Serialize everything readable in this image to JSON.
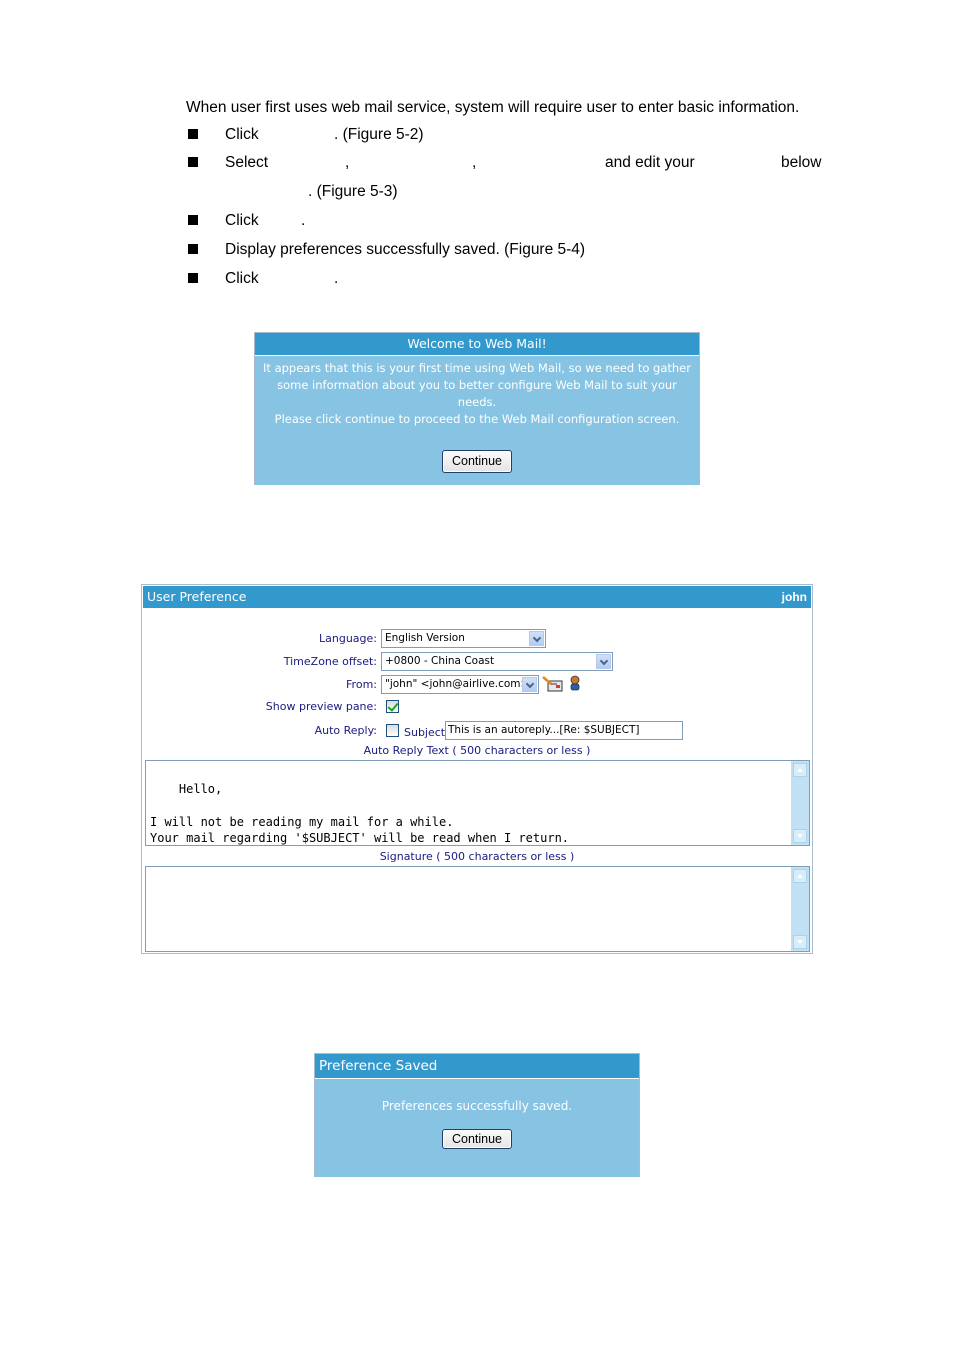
{
  "instructions": {
    "intro": "When user first uses web mail service, system will require user to enter basic information.",
    "steps": [
      {
        "prefix": "Click",
        "suffix": ". (Figure 5-2)"
      },
      {
        "prefix": "Select",
        "parts": [
          ",",
          ",",
          "and edit your",
          "below"
        ],
        "continuation": ". (Figure 5-3)"
      },
      {
        "prefix": "Click",
        "suffix": "."
      },
      {
        "text": "Display preferences successfully saved. (Figure 5-4)"
      },
      {
        "prefix": "Click",
        "suffix": "."
      }
    ]
  },
  "welcome_dialog": {
    "title": "Welcome to Web Mail!",
    "message_lines": [
      "It appears that this is your first time using Web Mail, so we need to gather",
      "some information about you to better configure Web Mail to suit your needs.",
      "Please click continue to proceed to the Web Mail configuration screen."
    ],
    "continue_label": "Continue"
  },
  "user_preference": {
    "title": "User Preference",
    "username": "john",
    "language": {
      "label": "Language:",
      "value": "English Version"
    },
    "timezone": {
      "label": "TimeZone offset:",
      "value": "+0800 - China Coast"
    },
    "from": {
      "label": "From:",
      "value": "\"john\" <john@airlive.com>"
    },
    "icons": [
      "edit-identity-icon",
      "address-book-user-icon"
    ],
    "show_preview": {
      "label": "Show preview pane:",
      "checked": true
    },
    "auto_reply": {
      "label": "Auto Reply:",
      "checked": false,
      "subject_label": "Subject:",
      "subject_value": "This is an autoreply...[Re: $SUBJECT]"
    },
    "auto_reply_text_caption": "Auto Reply Text ( 500 characters or less )",
    "auto_reply_text": "Hello,\n\nI will not be reading my mail for a while.\nYour mail regarding '$SUBJECT' will be read when I return.",
    "signature_caption": "Signature ( 500 characters or less )",
    "signature_text": ""
  },
  "saved_dialog": {
    "title": "Preference Saved",
    "message": "Preferences successfully saved.",
    "continue_label": "Continue"
  }
}
